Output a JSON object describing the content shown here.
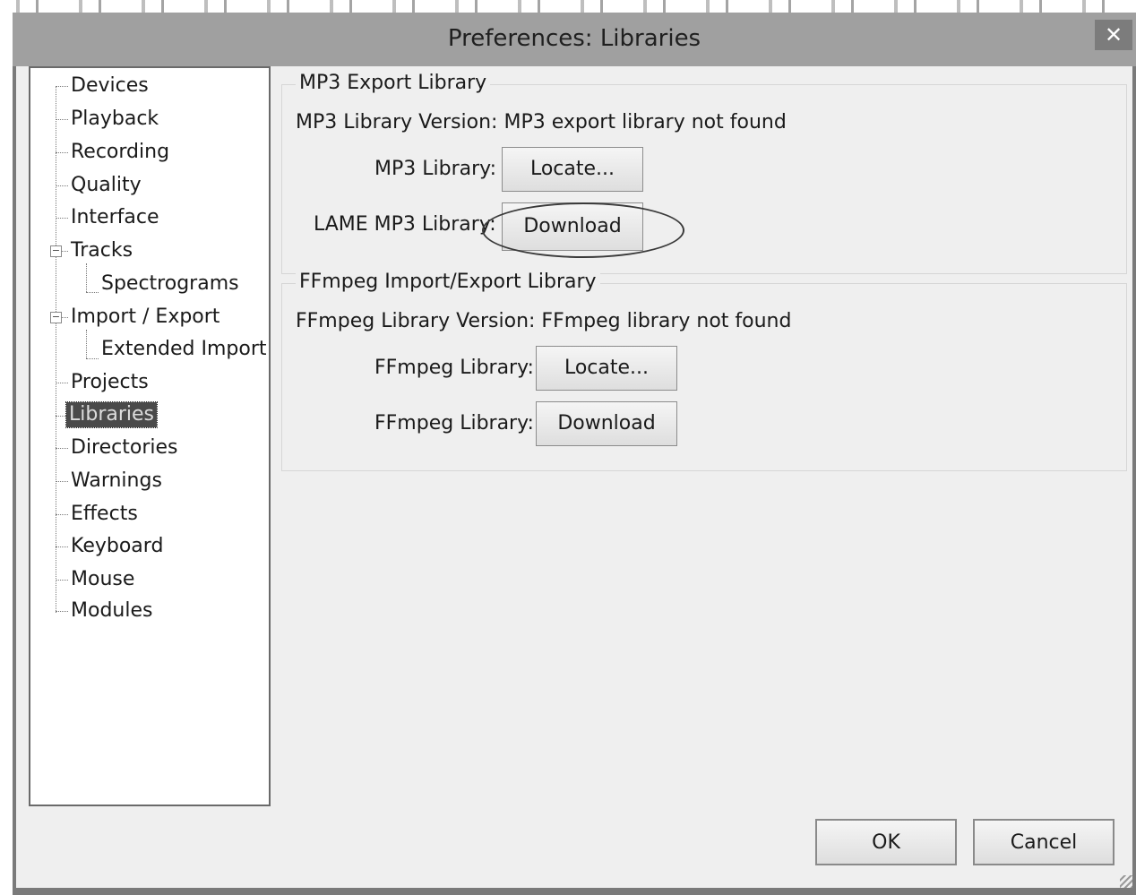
{
  "window": {
    "title": "Preferences: Libraries",
    "close_glyph": "✕"
  },
  "tree": {
    "items": [
      {
        "label": "Devices"
      },
      {
        "label": "Playback"
      },
      {
        "label": "Recording"
      },
      {
        "label": "Quality"
      },
      {
        "label": "Interface"
      },
      {
        "label": "Tracks"
      },
      {
        "label": "Spectrograms"
      },
      {
        "label": "Import / Export"
      },
      {
        "label": "Extended Import"
      },
      {
        "label": "Projects"
      },
      {
        "label": "Libraries"
      },
      {
        "label": "Directories"
      },
      {
        "label": "Warnings"
      },
      {
        "label": "Effects"
      },
      {
        "label": "Keyboard"
      },
      {
        "label": "Mouse"
      },
      {
        "label": "Modules"
      }
    ],
    "selected": "Libraries",
    "expander_glyph": "−"
  },
  "mp3_group": {
    "title": "MP3 Export Library",
    "version_text": "MP3 Library Version: MP3 export library not found",
    "library_label": "MP3 Library:",
    "locate_label": "Locate...",
    "lame_label": "LAME MP3 Library:",
    "download_label": "Download"
  },
  "ffmpeg_group": {
    "title": "FFmpeg Import/Export Library",
    "version_text": "FFmpeg Library Version: FFmpeg library not found",
    "library_label": "FFmpeg Library:",
    "locate_label": "Locate...",
    "library_label_2": "FFmpeg Library:",
    "download_label": "Download"
  },
  "footer": {
    "ok_label": "OK",
    "cancel_label": "Cancel"
  }
}
